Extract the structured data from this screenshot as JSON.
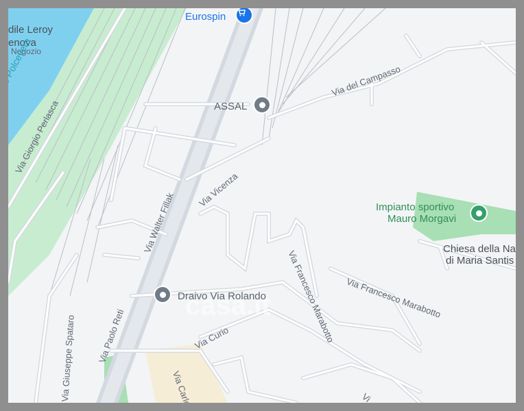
{
  "colors": {
    "river": "#7fd0ef",
    "park": "#a8dfb4",
    "rail_band": "#c8ecd0",
    "road_major": "#d3d9e0",
    "road_minor": "#ffffff",
    "background": "#f3f4f6",
    "sand": "#f6edd6",
    "pin_gray": "#6f7b86",
    "pin_green": "#34a06b",
    "pin_blue": "#1a73e8"
  },
  "places": {
    "leroy_line1": "dile Leroy",
    "leroy_line2": "enova",
    "leroy_sub": "Negozio",
    "river": "te Polcevera",
    "eurospin": "Eurospin",
    "assal": "ASSAL",
    "impianto_line1": "Impianto sportivo",
    "impianto_line2": "Mauro Morgavi",
    "chiesa_line1": "Chiesa della Na",
    "chiesa_line2": "di Maria Santis",
    "draivo": "Draivo Via Rolando"
  },
  "streets": {
    "perlasca": "Via Giorgio Perlasca",
    "campasso": "Via del Campasso",
    "vicenza": "Via Vicenza",
    "fillak": "Via Walter Fillak",
    "marabotto1": "Via Francesco Marabotto",
    "marabotto2": "Via Francesco Marabotto",
    "reti": "Via Paolo Reti",
    "spataro": "Via Giuseppe Spataro",
    "curio": "Via Curio",
    "carlo": "Via Carlo",
    "vi": "Vi"
  },
  "icons": {
    "eurospin": "shopping-cart-icon",
    "assal": "map-pin-icon",
    "impianto": "map-pin-icon",
    "draivo": "map-pin-icon"
  },
  "watermark": "casa.it"
}
